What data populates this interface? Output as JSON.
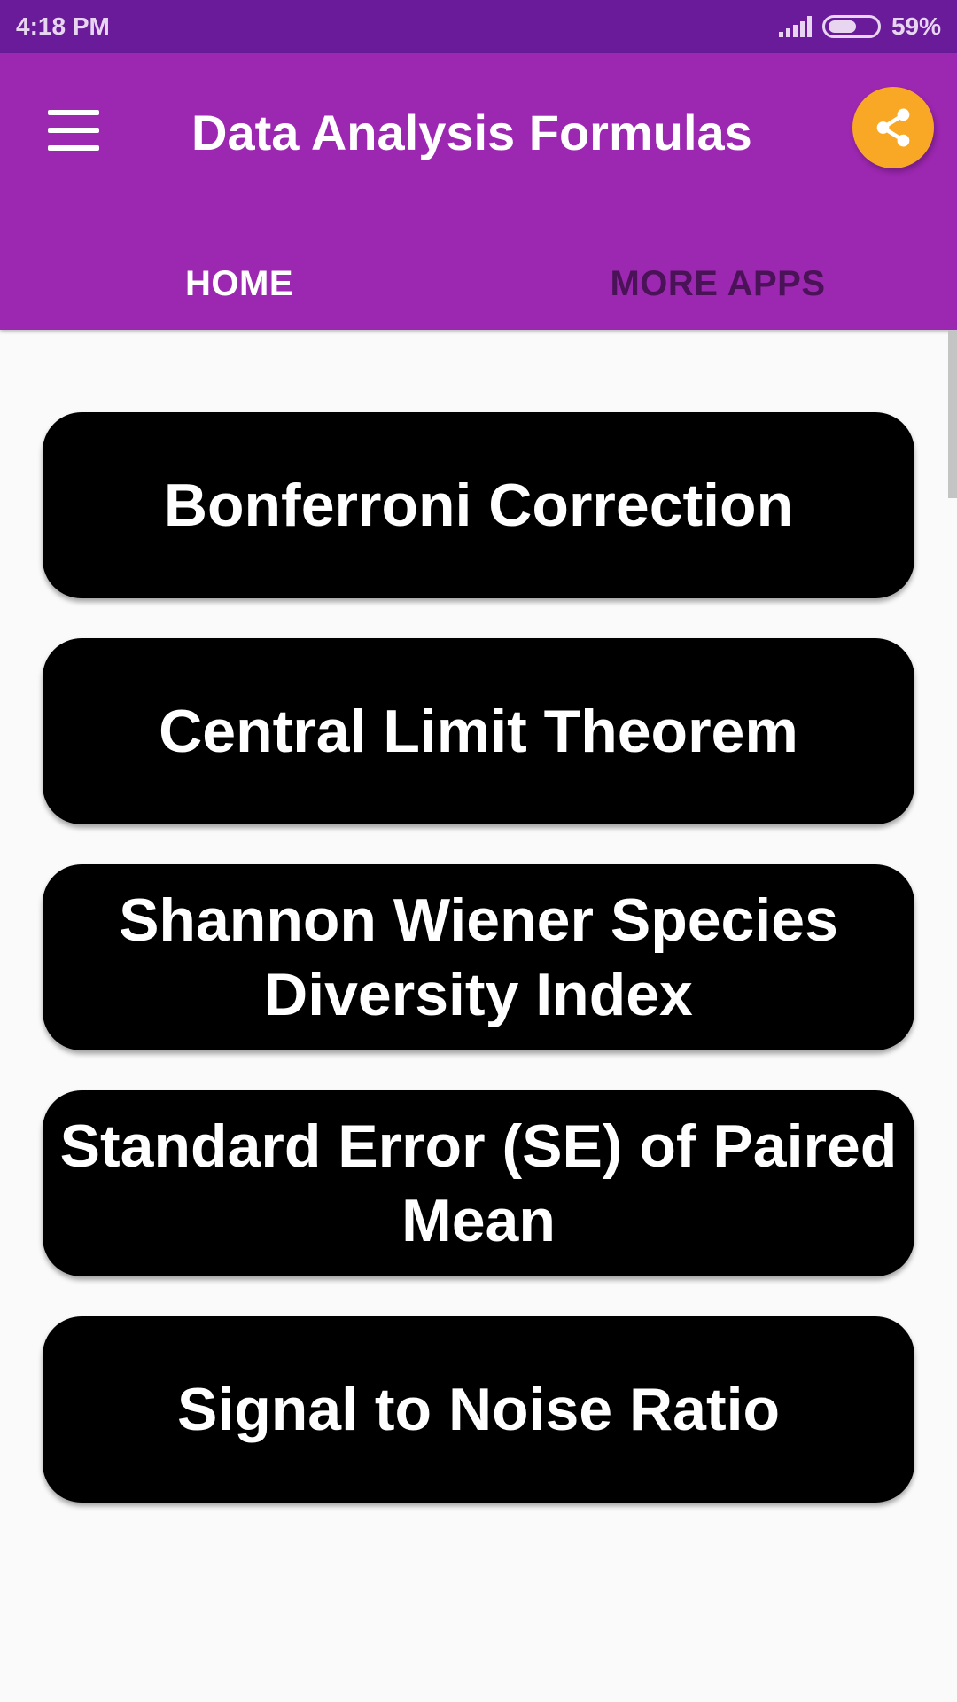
{
  "status_bar": {
    "time": "4:18 PM",
    "battery": "59%",
    "battery_level": 0.59,
    "signal_icon": "signal-bars-icon",
    "battery_icon": "battery-icon"
  },
  "app_bar": {
    "title": "Data Analysis Formulas",
    "menu_icon": "hamburger-menu-icon",
    "share_icon": "share-icon",
    "background_color": "#9c27b0",
    "share_button_color": "#f9a825"
  },
  "tabs": [
    {
      "label": "HOME",
      "selected": true
    },
    {
      "label": "MORE APPS",
      "selected": false
    }
  ],
  "formulas": [
    "Bonferroni Correction",
    "Central Limit Theorem",
    "Shannon Wiener Species Diversity Index",
    "Standard Error (SE) of Paired Mean",
    "Signal to Noise Ratio"
  ]
}
